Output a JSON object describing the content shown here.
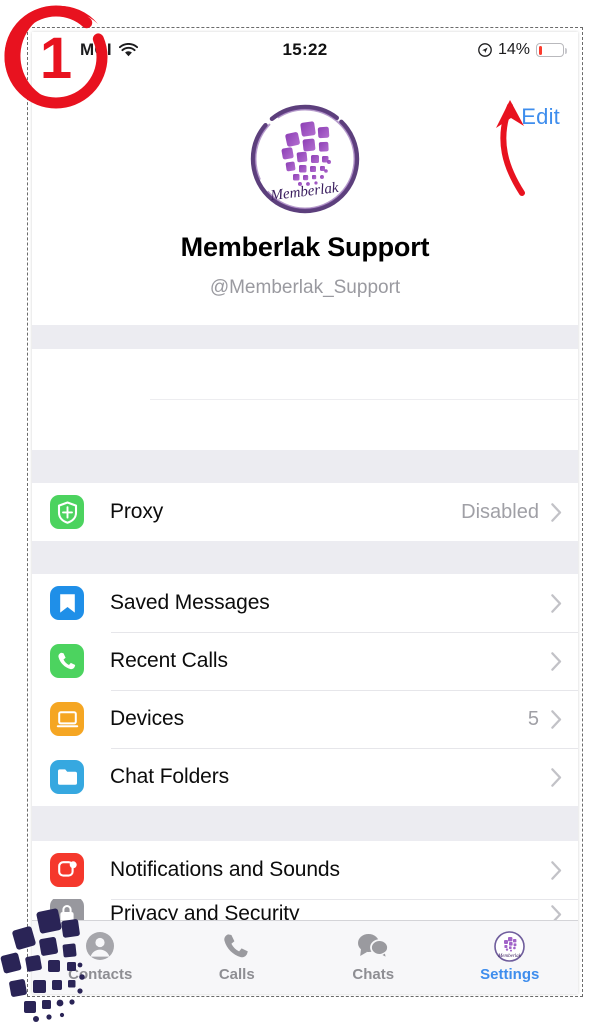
{
  "status_bar": {
    "carrier": "MCI",
    "wifi_icon": "wifi-icon",
    "time": "15:22",
    "location_icon": "location-services-icon",
    "battery_percent": "14%",
    "battery_level": 14,
    "battery_color": "#fc3b2d"
  },
  "header": {
    "edit_label": "Edit",
    "accent_color": "#3e8ded",
    "avatar_name": "memberlak-logo-avatar",
    "profile_name": "Memberlak Support",
    "username": "@Memberlak_Support"
  },
  "sections": [
    {
      "name": "redacted-info-section",
      "blank": true,
      "rows": 2
    },
    {
      "name": "proxy-section",
      "rows": [
        {
          "name": "proxy",
          "label": "Proxy",
          "value": "Disabled",
          "icon": "shield-icon",
          "icon_color": "#4cd35f",
          "chevron": true
        }
      ]
    },
    {
      "name": "general-section",
      "rows": [
        {
          "name": "saved-messages",
          "label": "Saved Messages",
          "value": "",
          "icon": "bookmark-icon",
          "icon_color": "#1f8fe8",
          "chevron": true
        },
        {
          "name": "recent-calls",
          "label": "Recent Calls",
          "value": "",
          "icon": "phone-icon",
          "icon_color": "#4cd35f",
          "chevron": true
        },
        {
          "name": "devices",
          "label": "Devices",
          "value": "5",
          "icon": "laptop-icon",
          "icon_color": "#f5a623",
          "chevron": true
        },
        {
          "name": "chat-folders",
          "label": "Chat Folders",
          "value": "",
          "icon": "folder-icon",
          "icon_color": "#36a8e0",
          "chevron": true
        }
      ]
    },
    {
      "name": "settings-section",
      "rows": [
        {
          "name": "notifications-and-sounds",
          "label": "Notifications and Sounds",
          "value": "",
          "icon": "notification-bell-icon",
          "icon_color": "#f5382c",
          "chevron": true
        },
        {
          "name": "privacy-and-security",
          "label": "Privacy and Security",
          "value": "",
          "icon": "lock-icon",
          "icon_color": "#98989e",
          "chevron": true,
          "clipped": true
        }
      ]
    }
  ],
  "tab_bar": {
    "tabs": [
      {
        "name": "contacts",
        "label": "Contacts",
        "icon": "person-circle-icon",
        "active": false
      },
      {
        "name": "calls",
        "label": "Calls",
        "icon": "phone-handset-icon",
        "active": false
      },
      {
        "name": "chats",
        "label": "Chats",
        "icon": "speech-bubbles-icon",
        "active": false
      },
      {
        "name": "settings",
        "label": "Settings",
        "icon": "profile-avatar-icon",
        "active": true
      }
    ],
    "inactive_color": "#8e8e93",
    "active_color": "#3e8ded"
  },
  "annotations": {
    "step_badge": "1",
    "step_badge_color": "#e8121f",
    "arrow_color": "#e8121f",
    "arrow_target": "edit-button",
    "watermark": "memberlak-squares-watermark",
    "watermark_color": "#2a2456"
  }
}
